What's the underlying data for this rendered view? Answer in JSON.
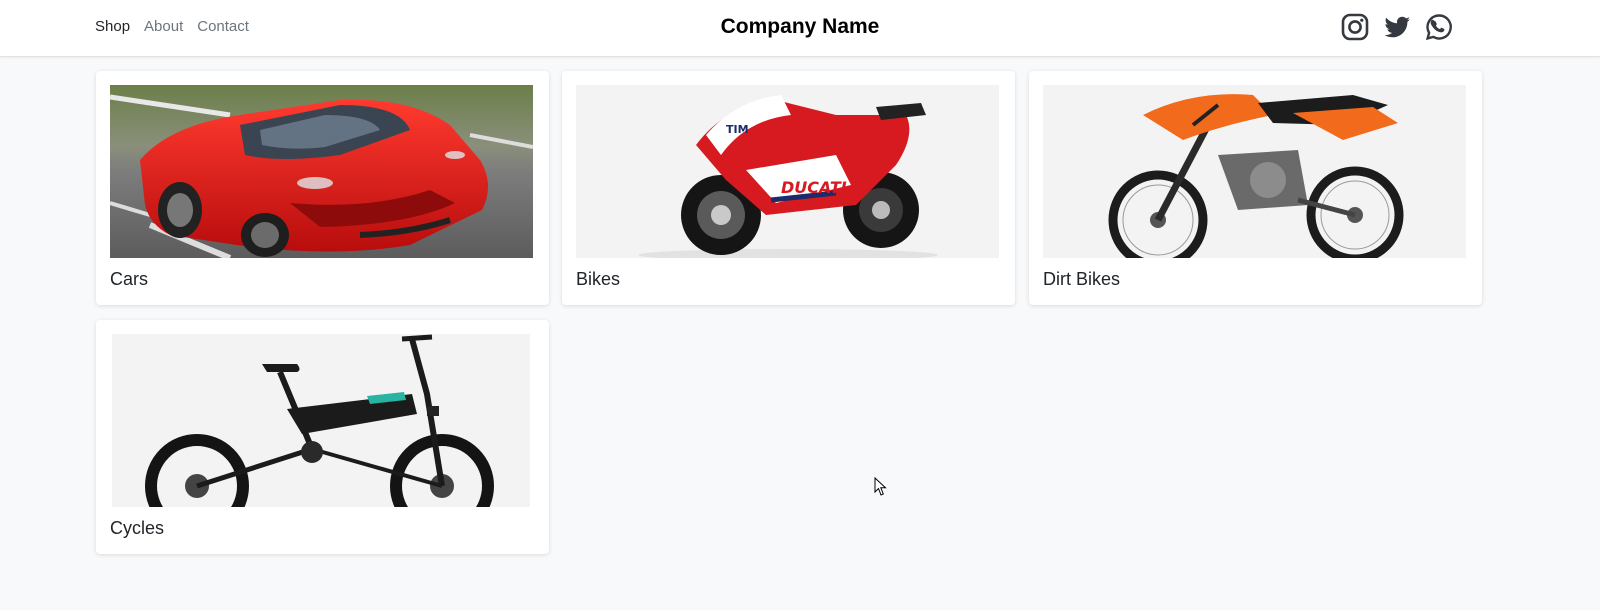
{
  "nav": {
    "links": [
      {
        "label": "Shop",
        "active": true
      },
      {
        "label": "About",
        "active": false
      },
      {
        "label": "Contact",
        "active": false
      }
    ],
    "brand": "Company Name",
    "social": [
      "instagram-icon",
      "twitter-icon",
      "whatsapp-icon"
    ]
  },
  "categories": [
    {
      "title": "Cars",
      "image": "red sports car"
    },
    {
      "title": "Bikes",
      "image": "red racing motorcycle"
    },
    {
      "title": "Dirt Bikes",
      "image": "orange dirt bike"
    },
    {
      "title": "Cycles",
      "image": "black folding electric bicycle"
    }
  ],
  "colors": {
    "accent": "#212529",
    "muted": "#6c757d",
    "background": "#f8f9fa"
  }
}
